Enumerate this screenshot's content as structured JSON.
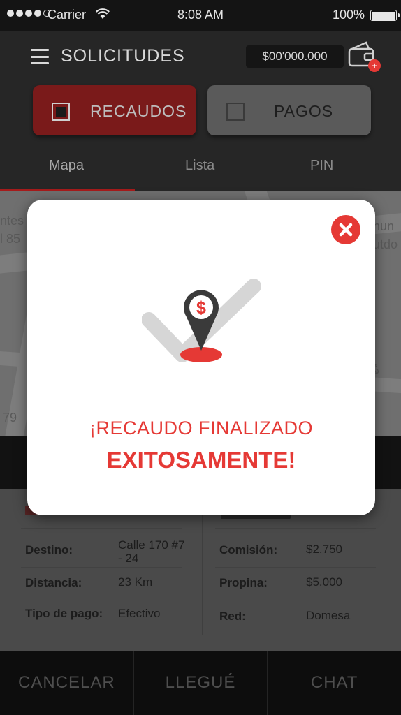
{
  "status_bar": {
    "carrier": "Carrier",
    "time": "8:08 AM",
    "battery": "100%"
  },
  "header": {
    "title": "SOLICITUDES",
    "balance": "$00'000.000",
    "wallet_badge": "+"
  },
  "type_tabs": {
    "recaudos": "RECAUDOS",
    "pagos": "PAGOS",
    "selected": "recaudos"
  },
  "view_tabs": [
    {
      "label": "Mapa",
      "active": true
    },
    {
      "label": "Lista",
      "active": false
    },
    {
      "label": "PIN",
      "active": false
    }
  ],
  "details": {
    "destino_label": "Destino:",
    "destino_value": "Calle 170 #7 - 24",
    "distancia_label": "Distancia:",
    "distancia_value": "23 Km",
    "tipo_pago_label": "Tipo de pago:",
    "tipo_pago_value": "Efectivo",
    "comision_label": "Comisión:",
    "comision_value": "$2.750",
    "propina_label": "Propina:",
    "propina_value": "$5.000",
    "red_label": "Red:",
    "red_value": "Domesa"
  },
  "bottom_bar": {
    "cancelar": "CANCELAR",
    "llegue": "LLEGUÉ",
    "chat": "CHAT"
  },
  "modal": {
    "line1": "¡RECAUDO FINALIZADO",
    "line2": "EXITOSAMENTE!",
    "pin_symbol": "$"
  },
  "colors": {
    "accent_red": "#e53935",
    "header_bg": "#262626",
    "modal_bg": "#ffffff"
  }
}
